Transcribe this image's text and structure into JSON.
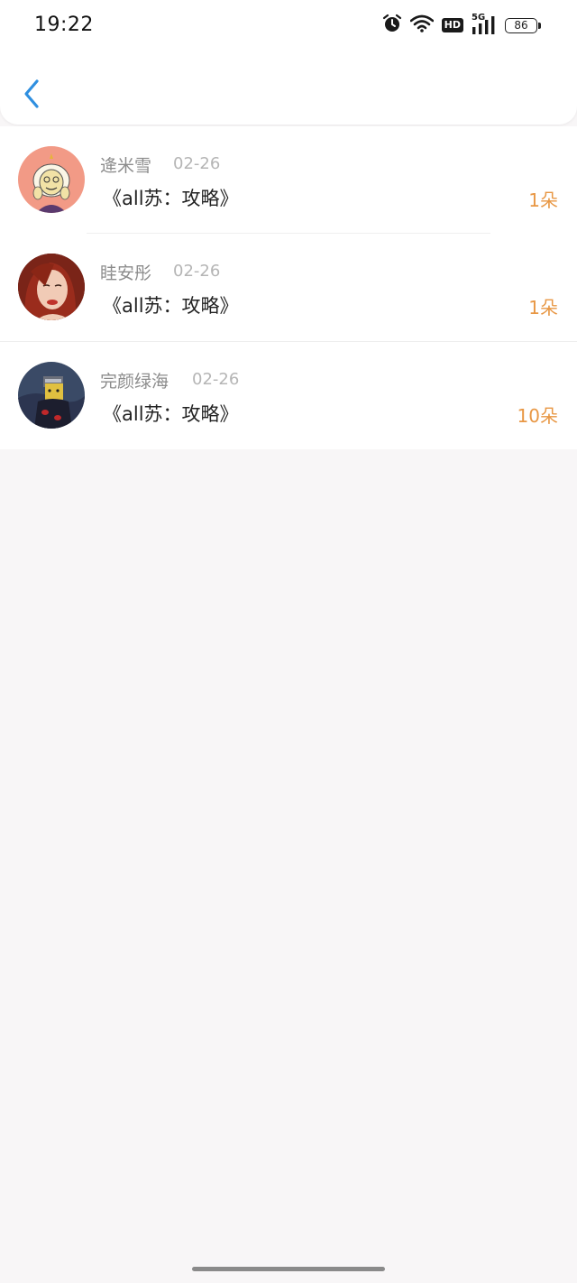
{
  "status_bar": {
    "time": "19:22",
    "hd_label": "HD",
    "network_label": "5G",
    "battery_level": "86"
  },
  "items": [
    {
      "name": "逄米雪",
      "date": "02-26",
      "title": "《all苏：攻略》",
      "count": "1朵"
    },
    {
      "name": "眭安彤",
      "date": "02-26",
      "title": "《all苏：攻略》",
      "count": "1朵"
    },
    {
      "name": "完颜绿海",
      "date": "02-26",
      "title": "《all苏：攻略》",
      "count": "10朵"
    }
  ],
  "colors": {
    "accent": "#2f8fe0",
    "count": "#e89744",
    "background": "#f8f6f7"
  }
}
